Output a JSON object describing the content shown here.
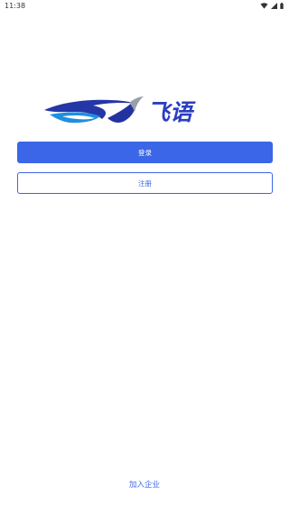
{
  "status_bar": {
    "time": "11:38",
    "icons": [
      "wifi-icon",
      "signal-icon",
      "battery-icon"
    ]
  },
  "brand": {
    "name": "飞语",
    "colors": {
      "primary": "#3b66e8",
      "logo_dark": "#2233a0",
      "logo_gray": "#9aa0aa"
    }
  },
  "auth": {
    "login_label": "登录",
    "register_label": "注册"
  },
  "footer": {
    "join_enterprise_label": "加入企业"
  }
}
